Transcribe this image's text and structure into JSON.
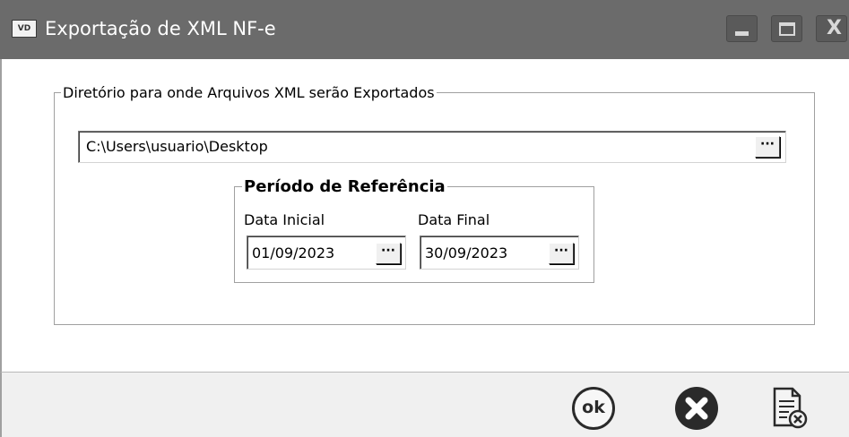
{
  "window": {
    "title": "Exportação de XML NF-e",
    "app_icon_text": "VD",
    "controls": [
      "minimize",
      "maximize",
      "close"
    ]
  },
  "directory_group": {
    "legend": "Diretório para onde Arquivos XML serão Exportados",
    "path_value": "C:\\Users\\usuario\\Desktop",
    "browse_label": "···"
  },
  "period_group": {
    "legend": "Período de Referência",
    "start_label": "Data Inicial",
    "start_value": "01/09/2023",
    "end_label": "Data Final",
    "end_value": "30/09/2023",
    "picker_label": "···"
  },
  "footer": {
    "ok_label": "ok",
    "icons": [
      "ok-icon",
      "cancel-icon",
      "document-cancel-icon"
    ]
  }
}
